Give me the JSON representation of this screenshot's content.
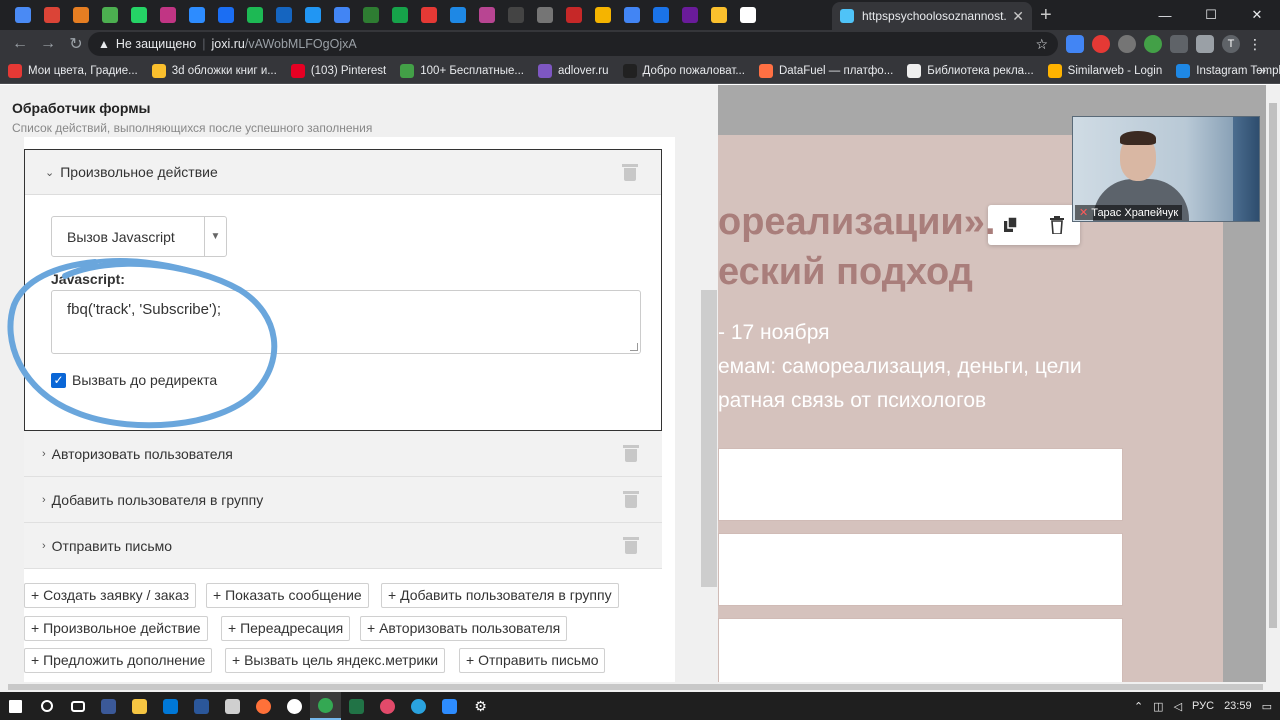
{
  "browser": {
    "active_tab_title": "httpspsychoolosoznannost.ruplin",
    "tab_close": "✕",
    "new_tab": "+",
    "tab_icon_colors": [
      "#4a8af4",
      "#db4437",
      "#e67e22",
      "#4caf50",
      "#25d366",
      "#c13584",
      "#2d8cff",
      "#1b6ef3",
      "#1db954",
      "#1565c0",
      "#2196f3",
      "#4285f4",
      "#2e7d32",
      "#16a34a",
      "#e53935",
      "#1e88e5",
      "#b84592",
      "#444444",
      "#757575",
      "#c62828",
      "#f5b400",
      "#4285f4",
      "#1a73e8",
      "#6a1b9a",
      "#fbc02d",
      "#ffffff"
    ],
    "url_warning": "Не защищено",
    "url_host": "joxi.ru",
    "url_path": "/vAWobMLFOgOjxA",
    "profile_initial": "T",
    "bookmarks": [
      {
        "label": "Мои цвета, Градие...",
        "color": "#e53935"
      },
      {
        "label": "3d обложки книг и...",
        "color": "#fbc02d"
      },
      {
        "label": "(103) Pinterest",
        "color": "#e60023"
      },
      {
        "label": "100+ Бесплатные...",
        "color": "#43a047"
      },
      {
        "label": "adlover.ru",
        "color": "#7e57c2"
      },
      {
        "label": "Добро пожаловат...",
        "color": "#212121"
      },
      {
        "label": "DataFuel — платфо...",
        "color": "#ff7043"
      },
      {
        "label": "Библиотека рекла...",
        "color": "#eeeeee"
      },
      {
        "label": "Similarweb - Login",
        "color": "#ffb300"
      },
      {
        "label": "Instagram Template...",
        "color": "#1e88e5"
      }
    ],
    "bookmarks_more": "»"
  },
  "form_handler": {
    "title": "Обработчик формы",
    "subtitle": "Список действий, выполняющихся после успешного заполнения",
    "open_action": {
      "header": "Произвольное действие",
      "select_value": "Вызов Javascript",
      "js_label": "Javascript:",
      "js_code": "fbq('track', 'Subscribe');",
      "checkbox_label": "Вызвать до редиректа",
      "checkbox_checked": true
    },
    "collapsed_actions": [
      "Авторизовать пользователя",
      "Добавить пользователя в группу",
      "Отправить письмо"
    ],
    "add_buttons": [
      "+ Создать заявку / заказ",
      "+ Показать сообщение",
      "+ Добавить пользователя в группу",
      "+ Произвольное действие",
      "+ Переадресация",
      "+ Авторизовать пользователя",
      "+ Предложить дополнение",
      "+ Вызвать цель яндекс.метрики",
      "+ Отправить письмо"
    ]
  },
  "site_preview": {
    "heading_line1": "ореализации».",
    "heading_line2": "еский подход",
    "line1": "- 17 ноября",
    "line2": "емам: самореализация, деньги, цели",
    "line3": "ратная связь от психологов",
    "heading_color": "#a97e7b",
    "bg_color": "#d5c2bd"
  },
  "video_call": {
    "participant_name": "Тарас Храпейчук"
  },
  "taskbar": {
    "language": "РУС",
    "time": "23:59"
  },
  "accent_colors": {
    "checkbox": "#0a66d6",
    "highlight_ring": "#6aa6dc"
  }
}
